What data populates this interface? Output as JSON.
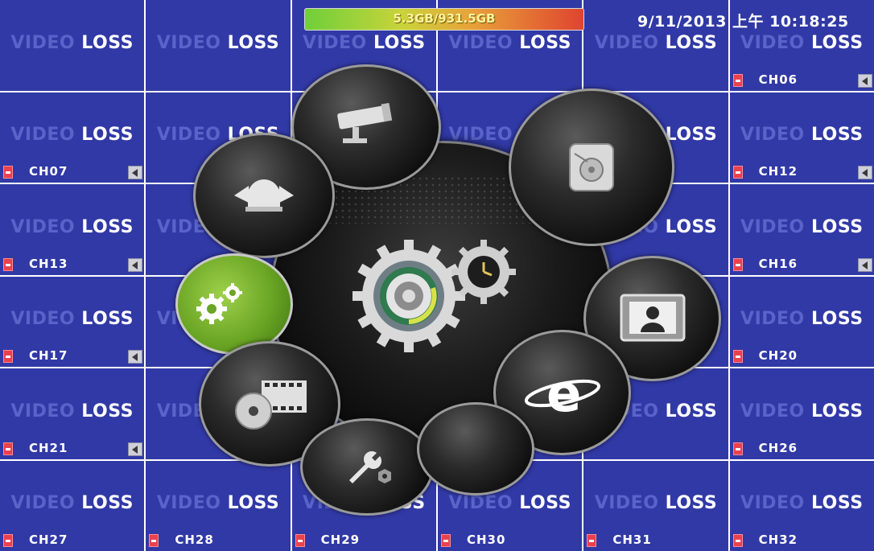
{
  "status": {
    "hdd_usage": "5.3GB/931.5GB",
    "datetime": "9/11/2013 上午 10:18:25"
  },
  "video_loss": {
    "dim": "VIDEO",
    "bright": "LOSS"
  },
  "channels": [
    {
      "label": ""
    },
    {
      "label": ""
    },
    {
      "label": ""
    },
    {
      "label": ""
    },
    {
      "label": ""
    },
    {
      "label": "CH06"
    },
    {
      "label": "CH07"
    },
    {
      "label": ""
    },
    {
      "label": ""
    },
    {
      "label": ""
    },
    {
      "label": ""
    },
    {
      "label": "CH12"
    },
    {
      "label": "CH13"
    },
    {
      "label": ""
    },
    {
      "label": ""
    },
    {
      "label": ""
    },
    {
      "label": ""
    },
    {
      "label": "CH16"
    },
    {
      "label": "CH17"
    },
    {
      "label": ""
    },
    {
      "label": ""
    },
    {
      "label": ""
    },
    {
      "label": ""
    },
    {
      "label": "CH20"
    },
    {
      "label": "CH21"
    },
    {
      "label": ""
    },
    {
      "label": ""
    },
    {
      "label": ""
    },
    {
      "label": ""
    },
    {
      "label": "CH26"
    },
    {
      "label": "CH27"
    },
    {
      "label": "CH28"
    },
    {
      "label": "CH29"
    },
    {
      "label": "CH30"
    },
    {
      "label": "CH31"
    },
    {
      "label": "CH32"
    }
  ],
  "menu": {
    "items": [
      {
        "icon": "camera-icon"
      },
      {
        "icon": "hard-disk-icon"
      },
      {
        "icon": "alarm-icon"
      },
      {
        "icon": "system-settings-icon",
        "active": true
      },
      {
        "icon": "display-icon"
      },
      {
        "icon": "playback-icon"
      },
      {
        "icon": "network-icon"
      },
      {
        "icon": "tools-icon"
      },
      {
        "icon": "main-settings-icon"
      }
    ]
  },
  "colors": {
    "grid_cell": "#3139a6",
    "active_petal": "#6aa524",
    "channel_text": "#ffffff"
  }
}
